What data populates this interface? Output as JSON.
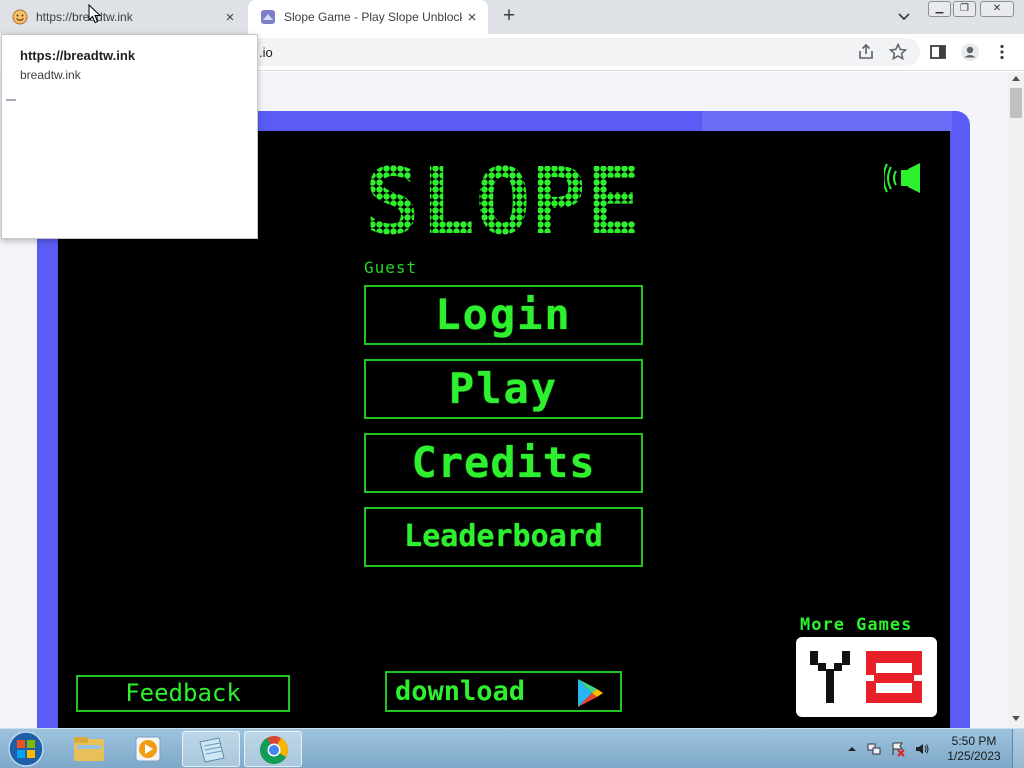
{
  "browser": {
    "tabs": [
      {
        "title": "https://breadtw.ink",
        "active": false,
        "favicon": "smiley-face-icon"
      },
      {
        "title": "Slope Game - Play Slope Unblocked",
        "active": true,
        "favicon": "slope-game-icon"
      }
    ],
    "new_tab_label": "+",
    "close_label": "×",
    "address_partial": ".io"
  },
  "hover_card": {
    "title": "https://breadtw.ink",
    "domain": "breadtw.ink"
  },
  "game": {
    "title": "SLOPE",
    "user_label": "Guest",
    "menu": [
      {
        "label": "Login"
      },
      {
        "label": "Play"
      },
      {
        "label": "Credits"
      },
      {
        "label": "Leaderboard"
      }
    ],
    "more_games_label": "More Games",
    "feedback_label": "Feedback",
    "download_label": "download",
    "colors": {
      "neon": "#2ef02e",
      "frame": "#5b5bf5",
      "bg": "#000000",
      "y8_red": "#e8202a"
    }
  },
  "taskbar": {
    "time": "5:50 PM",
    "date": "1/25/2023",
    "apps": [
      "file-explorer-icon",
      "media-player-icon",
      "notepad-icon",
      "chrome-icon"
    ]
  }
}
